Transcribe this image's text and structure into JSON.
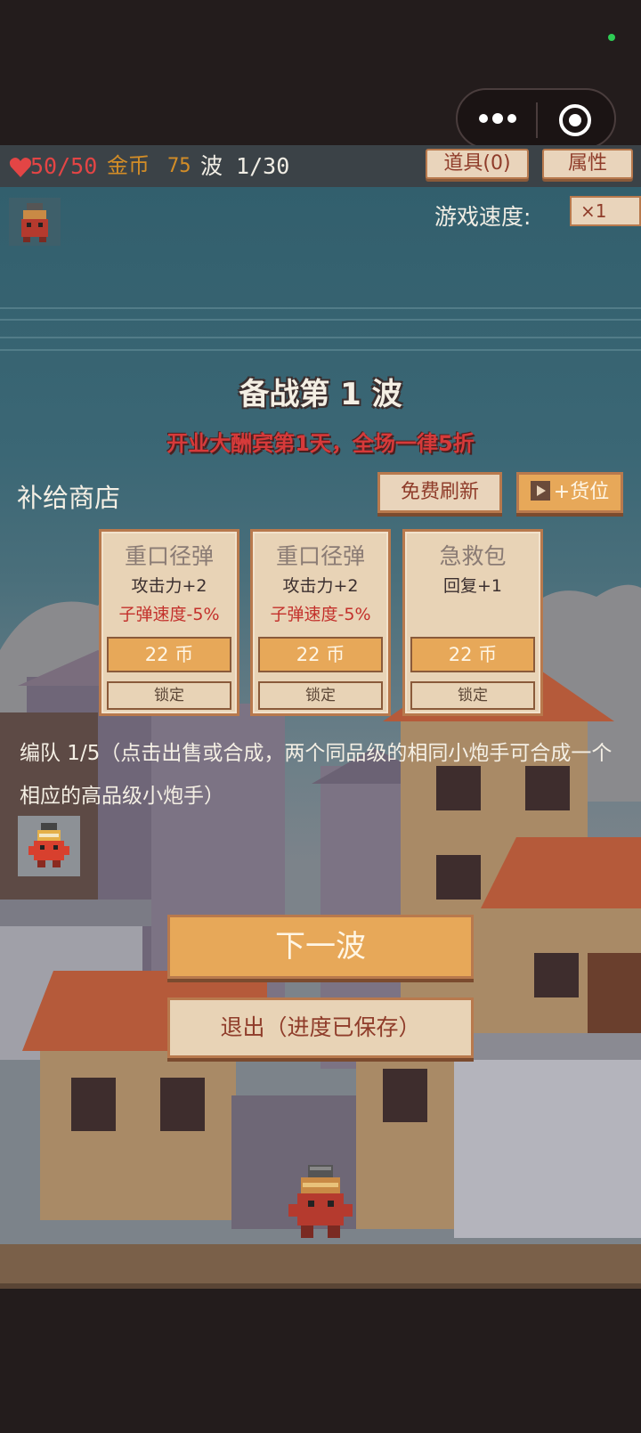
{
  "hud": {
    "hp": "50/50",
    "gold_label": "金币",
    "gold_value": "75",
    "wave": "波 1/30",
    "items_button": "道具(0)",
    "attributes_button": "属性"
  },
  "speed": {
    "label": "游戏速度:",
    "value": "×1"
  },
  "prep": {
    "title": "备战第 1 波",
    "promo": "开业大酬宾第1天，全场一律5折"
  },
  "shop": {
    "title": "补给商店",
    "refresh_button": "免费刷新",
    "slot_button": "+货位",
    "cards": [
      {
        "name": "重口径弹",
        "stat1": "攻击力+2",
        "stat2": "子弹速度-5%",
        "price": "22 币",
        "lock": "锁定"
      },
      {
        "name": "重口径弹",
        "stat1": "攻击力+2",
        "stat2": "子弹速度-5%",
        "price": "22 币",
        "lock": "锁定"
      },
      {
        "name": "急救包",
        "stat1": "回复+1",
        "stat2": "",
        "price": "22 币",
        "lock": "锁定"
      }
    ]
  },
  "team": {
    "text": "编队 1/5（点击出售或合成，两个同品级的相同小炮手可合成一个相应的高品级小炮手）"
  },
  "actions": {
    "next_wave": "下一波",
    "exit": "退出（进度已保存）"
  },
  "colors": {
    "hp": "#e34545",
    "gold": "#d38d27",
    "button_orange": "#e7a859",
    "button_beige": "#e8d3b6",
    "promo_red": "#d63a3a"
  }
}
